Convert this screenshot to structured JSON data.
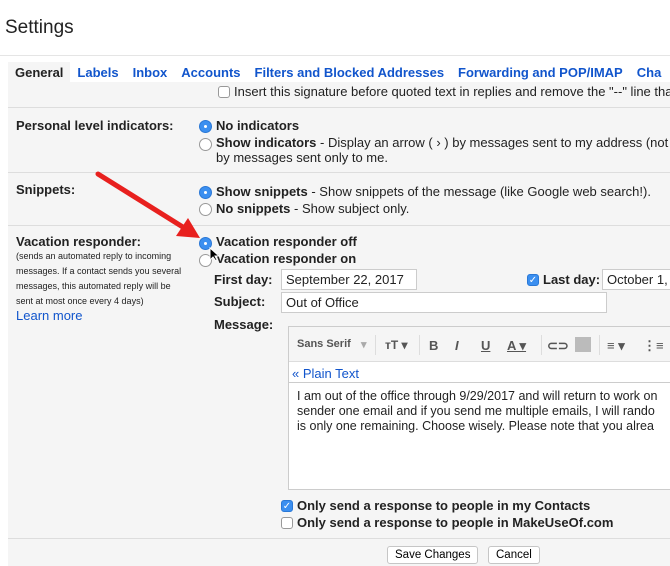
{
  "header": {
    "title": "Settings"
  },
  "tabs": [
    "General",
    "Labels",
    "Inbox",
    "Accounts",
    "Filters and Blocked Addresses",
    "Forwarding and POP/IMAP",
    "Cha"
  ],
  "signature": {
    "option": "Insert this signature before quoted text in replies and remove the \"--\" line tha",
    "checked": false
  },
  "personal": {
    "label": "Personal level indicators:",
    "opt1": "No indicators",
    "opt2_bold": "Show indicators",
    "opt2_rest": " - Display an arrow ( › ) by messages sent to my address (not",
    "opt2_line2": "by messages sent only to me.",
    "selected": "No indicators"
  },
  "snippets": {
    "label": "Snippets:",
    "opt1_bold": "Show snippets",
    "opt1_rest": " - Show snippets of the message (like Google web search!).",
    "opt2_bold": "No snippets",
    "opt2_rest": " - Show subject only.",
    "selected": "Show snippets"
  },
  "vacation": {
    "label": "Vacation responder:",
    "desc": [
      "(sends an automated reply to incoming",
      "messages. If a contact sends you several",
      "messages, this automated reply will be",
      "sent at most once every 4 days)"
    ],
    "learn_more": "Learn more",
    "opt_off": "Vacation responder off",
    "opt_on": "Vacation responder on",
    "selected": "Vacation responder off",
    "first_day_label": "First day:",
    "first_day": "September 22, 2017",
    "last_day_label": "Last day:",
    "last_day": "October 1,",
    "last_day_checked": true,
    "subject_label": "Subject:",
    "subject": "Out of Office",
    "message_label": "Message:",
    "toolbar": {
      "font": "Sans Serif",
      "size_icon": "text-size-icon",
      "bold_icon": "bold-icon",
      "italic_icon": "italic-icon",
      "underline_icon": "underline-icon",
      "color_icon": "text-color-icon",
      "link_icon": "link-icon",
      "image_icon": "image-icon",
      "align_icon": "align-icon",
      "list_icon": "numbered-list-icon"
    },
    "plain_text": "« Plain Text",
    "message": [
      "I am out of the office through 9/29/2017 and will return to work on",
      "sender one email and if you send me multiple emails, I will rando",
      "is only one remaining. Choose wisely. Please note that you alrea"
    ],
    "contacts_only": "Only send a response to people in my Contacts",
    "contacts_checked": true,
    "domain_only": "Only send a response to people in MakeUseOf.com",
    "domain_checked": false
  },
  "buttons": {
    "save": "Save Changes",
    "cancel": "Cancel"
  },
  "colors": {
    "accent": "#1155cc",
    "radio": "#3b8ff0",
    "arrow": "#e8201e"
  }
}
